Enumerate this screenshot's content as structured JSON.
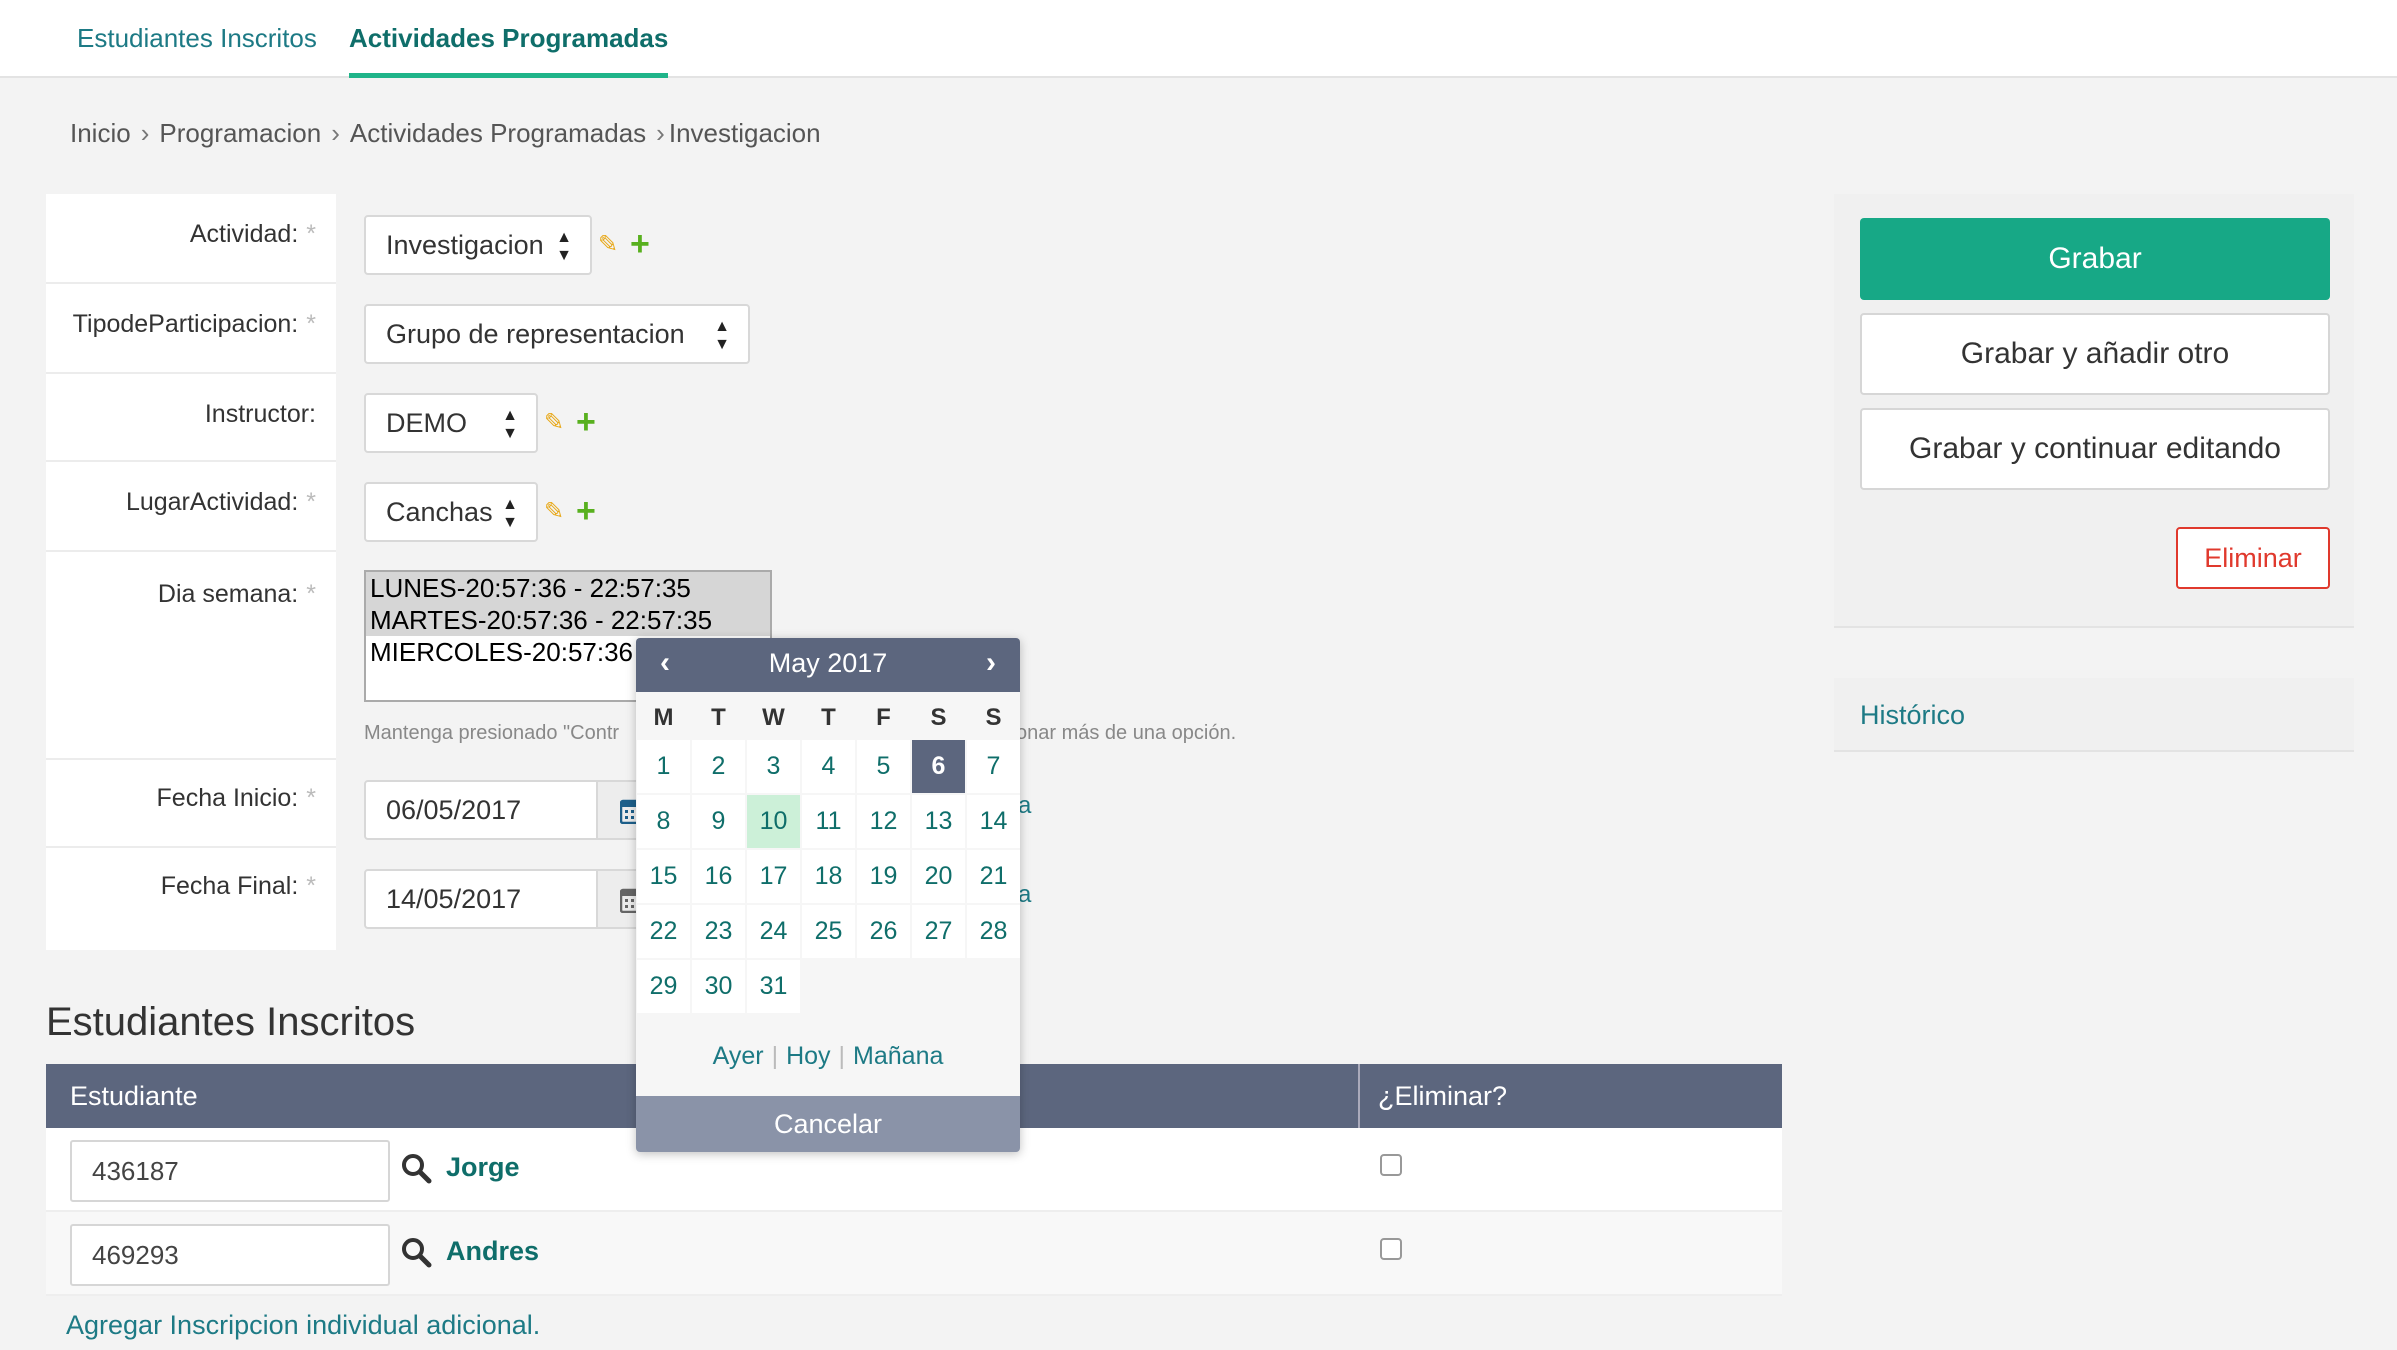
{
  "tabs": [
    "Estudiantes Inscritos",
    "Actividades Programadas"
  ],
  "breadcrumb": {
    "items": [
      "Inicio",
      "Programacion",
      "Actividades Programadas",
      "Investigacion"
    ],
    "separator": "›"
  },
  "form": {
    "required_mark": "*",
    "actividad": {
      "label": "Actividad:",
      "value": "Investigacion"
    },
    "tipo": {
      "label": "TipodeParticipacion:",
      "value": "Grupo de representacion"
    },
    "instructor": {
      "label": "Instructor:",
      "value": "DEMO"
    },
    "lugar": {
      "label": "LugarActividad:",
      "value": "Canchas"
    },
    "dia": {
      "label": "Dia semana:",
      "options": [
        "LUNES-20:57:36 - 22:57:35",
        "MARTES-20:57:36 - 22:57:35",
        "MIERCOLES-20:57:36 -"
      ],
      "help_left": "Mantenga presionado \"Contr",
      "help_right": "onar más de una opción."
    },
    "fecha_inicio": {
      "label": "Fecha Inicio:",
      "value": "06/05/2017"
    },
    "fecha_final": {
      "label": "Fecha Final:",
      "value": "14/05/2017"
    },
    "stray_char": "a"
  },
  "calendar": {
    "title": "May 2017",
    "prev": "‹",
    "next": "›",
    "weekdays": [
      "M",
      "T",
      "W",
      "T",
      "F",
      "S",
      "S"
    ],
    "days": [
      1,
      2,
      3,
      4,
      5,
      6,
      7,
      8,
      9,
      10,
      11,
      12,
      13,
      14,
      15,
      16,
      17,
      18,
      19,
      20,
      21,
      22,
      23,
      24,
      25,
      26,
      27,
      28,
      29,
      30,
      31
    ],
    "selected_day": 6,
    "today_day": 10,
    "shortcuts": {
      "ayer": "Ayer",
      "hoy": "Hoy",
      "manana": "Mañana",
      "sep": "|"
    },
    "cancel": "Cancelar"
  },
  "section": {
    "title": "Estudiantes Inscritos",
    "col_student": "Estudiante",
    "col_delete": "¿Eliminar?",
    "rows": [
      {
        "id": "436187",
        "name": "Jorge"
      },
      {
        "id": "469293",
        "name": "Andres"
      }
    ],
    "add_link": "Agregar Inscripcion individual adicional."
  },
  "actions": {
    "save": "Grabar",
    "save_add": "Grabar y añadir otro",
    "save_continue": "Grabar y continuar editando",
    "delete": "Eliminar",
    "history": "Histórico"
  },
  "colors": {
    "primary": "#17a886",
    "header": "#5c667e",
    "link": "#1d7a85",
    "danger": "#e0392d",
    "today": "#ccf0d8"
  }
}
